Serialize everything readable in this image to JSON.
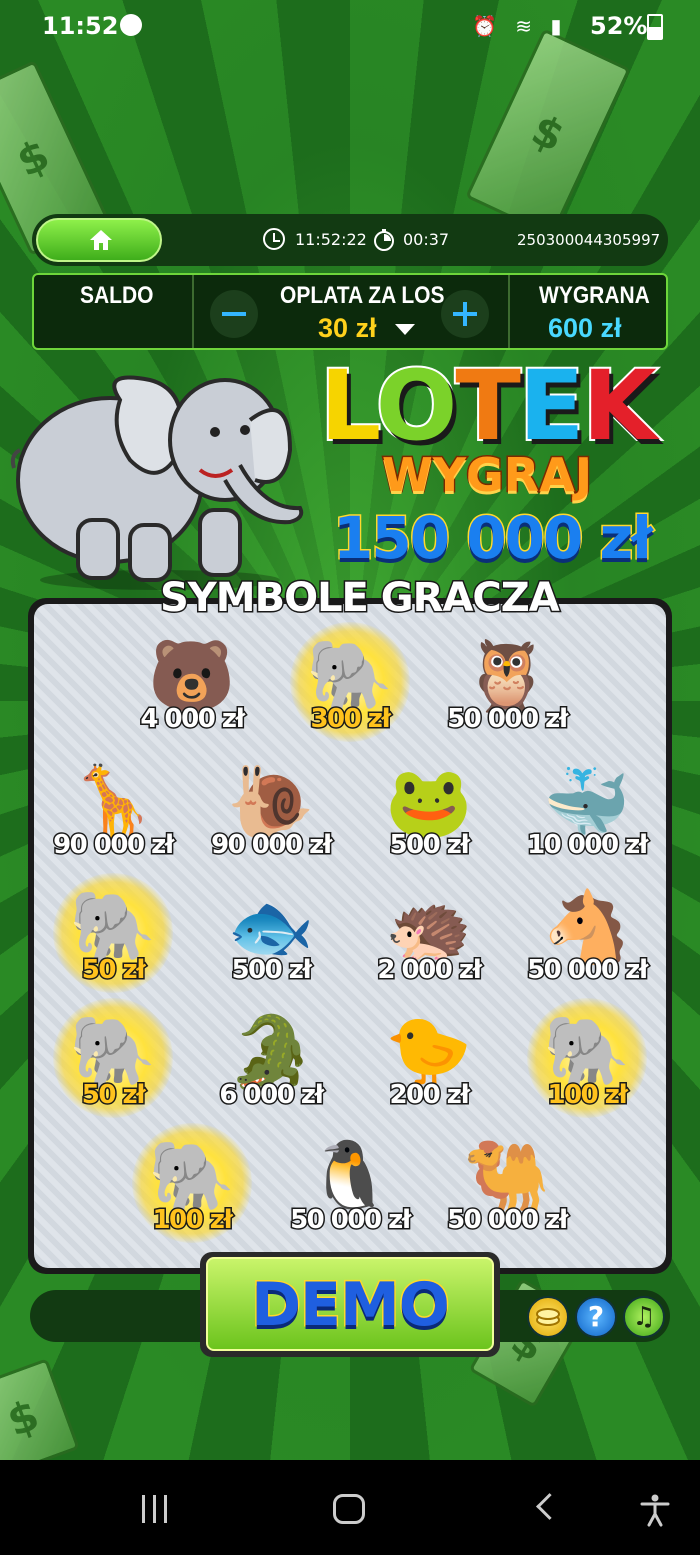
{
  "status_bar": {
    "time": "11:52",
    "battery": "52%"
  },
  "header": {
    "clock": "11:52:22",
    "timer": "00:37",
    "ticket_id": "250300044305997"
  },
  "panel": {
    "saldo_label": "SALDO",
    "saldo_value": "",
    "oplata_label": "OPLATA ZA LOS",
    "oplata_value": "30 zł",
    "wygrana_label": "WYGRANA",
    "wygrana_value": "600 zł"
  },
  "logo": {
    "letters": [
      "L",
      "O",
      "T",
      "E",
      "K"
    ],
    "subtitle": "WYGRAJ",
    "jackpot": "150 000 zł"
  },
  "board": {
    "title": "SYMBOLE GRACZA",
    "symbols": [
      {
        "icon": "bear-icon",
        "glyph": "🐻",
        "prize": "4 000 zł",
        "win": false
      },
      {
        "icon": "elephant-icon",
        "glyph": "🐘",
        "prize": "300 zł",
        "win": true
      },
      {
        "icon": "owl-icon",
        "glyph": "🦉",
        "prize": "50 000 zł",
        "win": false
      },
      {
        "icon": "giraffe-icon",
        "glyph": "🦒",
        "prize": "90 000 zł",
        "win": false
      },
      {
        "icon": "snail-icon",
        "glyph": "🐌",
        "prize": "90 000 zł",
        "win": false
      },
      {
        "icon": "frog-icon",
        "glyph": "🐸",
        "prize": "500 zł",
        "win": false
      },
      {
        "icon": "whale-icon",
        "glyph": "🐳",
        "prize": "10 000 zł",
        "win": false
      },
      {
        "icon": "elephant-icon",
        "glyph": "🐘",
        "prize": "50 zł",
        "win": true
      },
      {
        "icon": "fish-icon",
        "glyph": "🐟",
        "prize": "500 zł",
        "win": false
      },
      {
        "icon": "hedgehog-icon",
        "glyph": "🦔",
        "prize": "2 000 zł",
        "win": false
      },
      {
        "icon": "horse-icon",
        "glyph": "🐴",
        "prize": "50 000 zł",
        "win": false
      },
      {
        "icon": "elephant-icon",
        "glyph": "🐘",
        "prize": "50 zł",
        "win": true
      },
      {
        "icon": "crocodile-icon",
        "glyph": "🐊",
        "prize": "6 000 zł",
        "win": false
      },
      {
        "icon": "chick-icon",
        "glyph": "🐤",
        "prize": "200 zł",
        "win": false
      },
      {
        "icon": "elephant-icon",
        "glyph": "🐘",
        "prize": "100 zł",
        "win": true
      },
      {
        "icon": "elephant-icon",
        "glyph": "🐘",
        "prize": "100 zł",
        "win": true
      },
      {
        "icon": "penguin-icon",
        "glyph": "🐧",
        "prize": "50 000 zł",
        "win": false
      },
      {
        "icon": "camel-icon",
        "glyph": "🐫",
        "prize": "50 000 zł",
        "win": false
      }
    ]
  },
  "controls": {
    "demo_label": "DEMO",
    "help_glyph": "?",
    "music_glyph": "♫"
  },
  "colors": {
    "background_green": "#1d6d1c",
    "accent_green": "#6ed63b",
    "price_yellow": "#ffd21c",
    "win_blue": "#49d9ff"
  }
}
